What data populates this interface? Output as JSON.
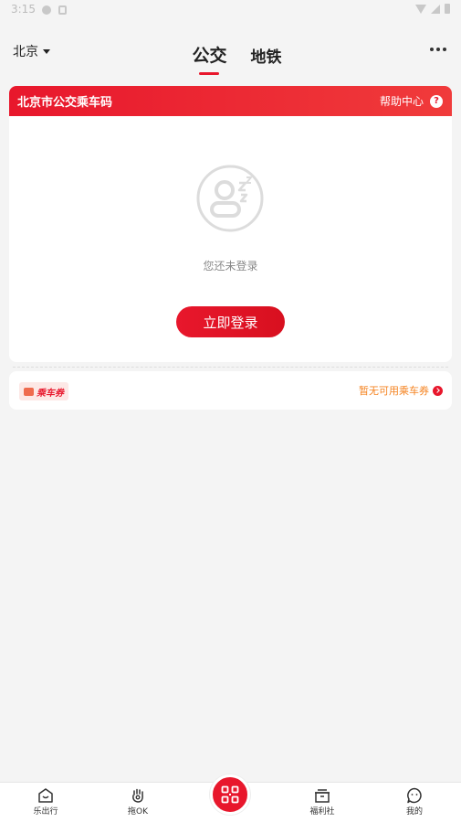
{
  "status_bar": {
    "time": "3:15"
  },
  "header": {
    "city": "北京",
    "tabs": [
      {
        "label": "公交",
        "active": true
      },
      {
        "label": "地铁",
        "active": false
      }
    ]
  },
  "bus_card": {
    "title": "北京市公交乘车码",
    "help_label": "帮助中心",
    "help_icon": "?",
    "not_logged_in_text": "您还未登录",
    "login_button": "立即登录"
  },
  "voucher": {
    "tag_label": "乘车券",
    "status_text": "暂无可用乘车券"
  },
  "bottom_nav": {
    "items": [
      {
        "label": "乐出行",
        "icon": "home-smile-icon"
      },
      {
        "label": "拖OK",
        "icon": "hand-icon"
      },
      {
        "label": "",
        "icon": "qr-code-icon"
      },
      {
        "label": "福利社",
        "icon": "gift-box-icon"
      },
      {
        "label": "我的",
        "icon": "profile-icon"
      }
    ]
  },
  "colors": {
    "accent": "#e8172c",
    "voucher_text": "#f58320",
    "background": "#f4f4f4"
  }
}
